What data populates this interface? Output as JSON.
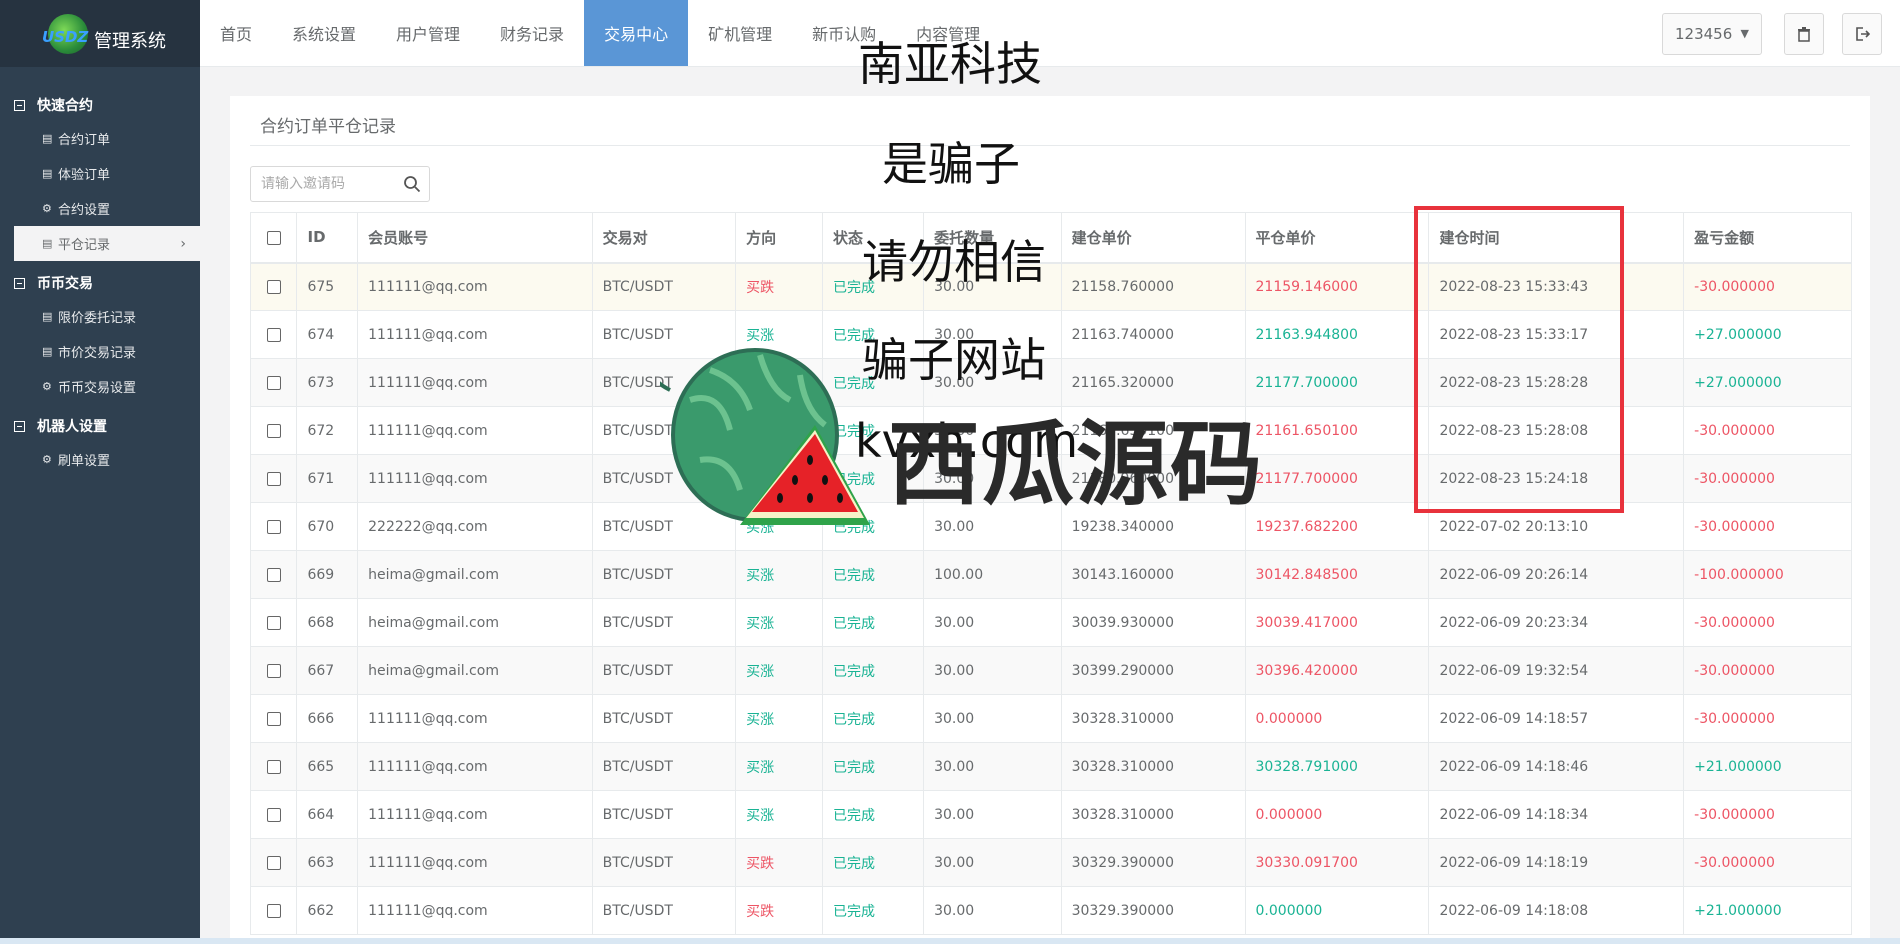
{
  "app": {
    "title": "管理系统",
    "logo_text": "USDZ"
  },
  "sidebar": {
    "groups": [
      {
        "label": "快速合约",
        "items": [
          {
            "label": "合约订单",
            "icon": "list-icon"
          },
          {
            "label": "体验订单",
            "icon": "list-icon"
          },
          {
            "label": "合约设置",
            "icon": "gear-icon"
          },
          {
            "label": "平仓记录",
            "icon": "list-icon",
            "active": true
          }
        ]
      },
      {
        "label": "币币交易",
        "items": [
          {
            "label": "限价委托记录",
            "icon": "list-icon"
          },
          {
            "label": "市价交易记录",
            "icon": "list-icon"
          },
          {
            "label": "币币交易设置",
            "icon": "gear-icon"
          }
        ]
      },
      {
        "label": "机器人设置",
        "items": [
          {
            "label": "刷单设置",
            "icon": "gear-icon"
          }
        ]
      }
    ]
  },
  "topnav": {
    "items": [
      "首页",
      "系统设置",
      "用户管理",
      "财务记录",
      "交易中心",
      "矿机管理",
      "新币认购",
      "内容管理"
    ],
    "active": "交易中心",
    "user": "123456"
  },
  "panel": {
    "title": "合约订单平仓记录",
    "search_placeholder": "请输入邀请码"
  },
  "table": {
    "headers": [
      "ID",
      "会员账号",
      "交易对",
      "方向",
      "状态",
      "委托数量",
      "建仓单价",
      "平仓单价",
      "建仓时间",
      "盈亏金额"
    ],
    "rows": [
      {
        "id": "675",
        "account": "111111@qq.com",
        "pair": "BTC/USDT",
        "dir": "买跌",
        "status": "已完成",
        "qty": "30.00",
        "open": "21158.760000",
        "close": "21159.146000",
        "time": "2022-08-23 15:33:43",
        "pnl": "-30.000000"
      },
      {
        "id": "674",
        "account": "111111@qq.com",
        "pair": "BTC/USDT",
        "dir": "买涨",
        "status": "已完成",
        "qty": "30.00",
        "open": "21163.740000",
        "close": "21163.944800",
        "time": "2022-08-23 15:33:17",
        "pnl": "+27.000000"
      },
      {
        "id": "673",
        "account": "111111@qq.com",
        "pair": "BTC/USDT",
        "dir": "买涨",
        "status": "已完成",
        "qty": "30.00",
        "open": "21165.320000",
        "close": "21177.700000",
        "time": "2022-08-23 15:28:28",
        "pnl": "+27.000000"
      },
      {
        "id": "672",
        "account": "111111@qq.com",
        "pair": "BTC/USDT",
        "dir": "买涨",
        "status": "已完成",
        "qty": "30.00",
        "open": "21161.650100",
        "close": "21161.650100",
        "time": "2022-08-23 15:28:08",
        "pnl": "-30.000000"
      },
      {
        "id": "671",
        "account": "111111@qq.com",
        "pair": "BTC/USDT",
        "dir": "买涨",
        "status": "已完成",
        "qty": "30.00",
        "open": "21180.960000",
        "close": "21177.700000",
        "time": "2022-08-23 15:24:18",
        "pnl": "-30.000000"
      },
      {
        "id": "670",
        "account": "222222@qq.com",
        "pair": "BTC/USDT",
        "dir": "买涨",
        "status": "已完成",
        "qty": "30.00",
        "open": "19238.340000",
        "close": "19237.682200",
        "time": "2022-07-02 20:13:10",
        "pnl": "-30.000000"
      },
      {
        "id": "669",
        "account": "heima@gmail.com",
        "pair": "BTC/USDT",
        "dir": "买涨",
        "status": "已完成",
        "qty": "100.00",
        "open": "30143.160000",
        "close": "30142.848500",
        "time": "2022-06-09 20:26:14",
        "pnl": "-100.000000"
      },
      {
        "id": "668",
        "account": "heima@gmail.com",
        "pair": "BTC/USDT",
        "dir": "买涨",
        "status": "已完成",
        "qty": "30.00",
        "open": "30039.930000",
        "close": "30039.417000",
        "time": "2022-06-09 20:23:34",
        "pnl": "-30.000000"
      },
      {
        "id": "667",
        "account": "heima@gmail.com",
        "pair": "BTC/USDT",
        "dir": "买涨",
        "status": "已完成",
        "qty": "30.00",
        "open": "30399.290000",
        "close": "30396.420000",
        "time": "2022-06-09 19:32:54",
        "pnl": "-30.000000"
      },
      {
        "id": "666",
        "account": "111111@qq.com",
        "pair": "BTC/USDT",
        "dir": "买涨",
        "status": "已完成",
        "qty": "30.00",
        "open": "30328.310000",
        "close": "0.000000",
        "time": "2022-06-09 14:18:57",
        "pnl": "-30.000000"
      },
      {
        "id": "665",
        "account": "111111@qq.com",
        "pair": "BTC/USDT",
        "dir": "买涨",
        "status": "已完成",
        "qty": "30.00",
        "open": "30328.310000",
        "close": "30328.791000",
        "time": "2022-06-09 14:18:46",
        "pnl": "+21.000000"
      },
      {
        "id": "664",
        "account": "111111@qq.com",
        "pair": "BTC/USDT",
        "dir": "买涨",
        "status": "已完成",
        "qty": "30.00",
        "open": "30328.310000",
        "close": "0.000000",
        "time": "2022-06-09 14:18:34",
        "pnl": "-30.000000"
      },
      {
        "id": "663",
        "account": "111111@qq.com",
        "pair": "BTC/USDT",
        "dir": "买跌",
        "status": "已完成",
        "qty": "30.00",
        "open": "30329.390000",
        "close": "30330.091700",
        "time": "2022-06-09 14:18:19",
        "pnl": "-30.000000"
      },
      {
        "id": "662",
        "account": "111111@qq.com",
        "pair": "BTC/USDT",
        "dir": "买跌",
        "status": "已完成",
        "qty": "30.00",
        "open": "30329.390000",
        "close": "0.000000",
        "time": "2022-06-09 14:18:08",
        "pnl": "+21.000000"
      }
    ]
  },
  "overlay": {
    "lines": [
      "南亚科技",
      "是骗子",
      "请勿相信",
      "骗子网站",
      "kvxh.com"
    ],
    "brand": "西瓜源码"
  },
  "colors": {
    "sidebar": "#2f4050",
    "accent": "#5a96d6",
    "red": "#ed5565",
    "green": "#1ab394",
    "highlight": "#e8323c"
  }
}
